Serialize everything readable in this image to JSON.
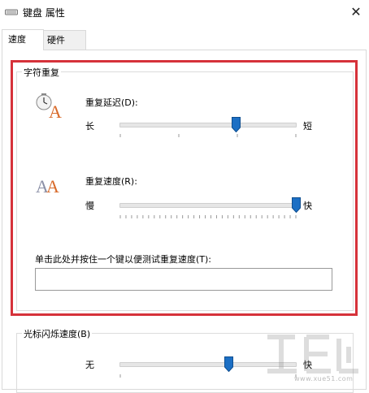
{
  "window": {
    "title": "键盘 属性",
    "close_glyph": "✕"
  },
  "tabs": [
    {
      "label": "速度",
      "active": true
    },
    {
      "label": "硬件",
      "active": false
    }
  ],
  "char_repeat": {
    "group_label": "字符重复",
    "delay": {
      "label": "重复延迟(D):",
      "left_label": "长",
      "right_label": "短",
      "value_fraction": 0.66,
      "tick_count": 4
    },
    "rate": {
      "label": "重复速度(R):",
      "left_label": "慢",
      "right_label": "快",
      "value_fraction": 1.0,
      "tick_count": 32
    },
    "test": {
      "label": "单击此处并按住一个键以便测试重复速度(T):",
      "value": ""
    }
  },
  "cursor_blink": {
    "group_label": "光标闪烁速度(B)",
    "left_label": "无",
    "right_label": "快",
    "value_fraction": 0.62,
    "tick_count": 2
  },
  "colors": {
    "thumb": "#1c6fc4",
    "highlight": "#d6323a"
  },
  "watermark": {
    "text": "www.xue51.com"
  }
}
